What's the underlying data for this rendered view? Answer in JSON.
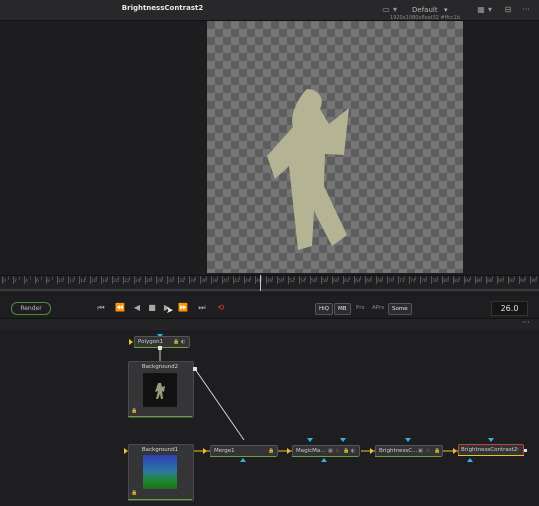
{
  "viewer": {
    "title": "BrightnessContrast2",
    "layout_label": "Default",
    "canvas_info": "1920x1080xfloat32 #ffcc1b"
  },
  "ruler": {
    "labels": [
      "0",
      "2",
      "4",
      "6",
      "8",
      "10",
      "12",
      "14",
      "16",
      "18",
      "20",
      "22",
      "24",
      "26",
      "28",
      "30",
      "32",
      "34",
      "36",
      "38",
      "40",
      "42",
      "44",
      "46",
      "48",
      "50",
      "52",
      "54",
      "56",
      "58",
      "60",
      "62",
      "64",
      "66",
      "68",
      "70",
      "72",
      "74",
      "76",
      "78",
      "80",
      "82",
      "84",
      "86",
      "88",
      "90",
      "92",
      "94",
      "96",
      "98"
    ]
  },
  "transport": {
    "render_label": "Render",
    "quality_buttons": [
      {
        "label": "HiQ",
        "active": true
      },
      {
        "label": "MB",
        "active": true
      },
      {
        "label": "Prx",
        "active": false
      },
      {
        "label": "APrx",
        "active": false
      },
      {
        "label": "Some",
        "active": true
      }
    ],
    "current_frame": "26.0"
  },
  "nodes": {
    "polygon1": "Polygon1",
    "background2": "Background2",
    "background1": "Background1",
    "merge1": "Merge1",
    "magicmask": "MagicMa...",
    "brightness1": "BrightnessC...",
    "brightness2": "BrightnessContrast2"
  },
  "colors": {
    "figure_fill": "#b4b495",
    "accent_green": "#6aa13e",
    "accent_red": "#d94a3a",
    "port_blue": "#3ab0e0",
    "port_yellow": "#e8c428"
  }
}
